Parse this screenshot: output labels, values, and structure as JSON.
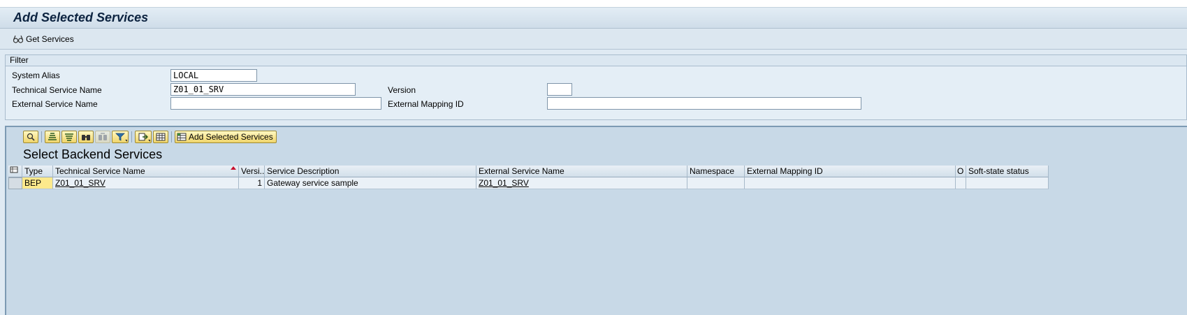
{
  "window": {
    "title": "Add Selected Services"
  },
  "app_toolbar": {
    "get_services_label": "Get Services",
    "get_services_icon": "glasses-icon"
  },
  "filter": {
    "legend": "Filter",
    "system_alias": {
      "label": "System Alias",
      "value": "LOCAL"
    },
    "technical_service_name": {
      "label": "Technical Service Name",
      "value": "Z01_01_SRV"
    },
    "external_service_name": {
      "label": "External Service Name",
      "value": ""
    },
    "version": {
      "label": "Version",
      "value": ""
    },
    "external_mapping_id": {
      "label": "External Mapping ID",
      "value": ""
    }
  },
  "grid": {
    "title": "Select Backend Services",
    "toolbar": {
      "buttons": [
        {
          "name": "details-icon"
        },
        {
          "name": "sort-ascending-icon"
        },
        {
          "name": "sort-descending-icon"
        },
        {
          "name": "find-icon"
        },
        {
          "name": "find-next-icon",
          "disabled": true
        },
        {
          "name": "filter-icon",
          "dropdown": true
        },
        {
          "name": "export-icon",
          "dropdown": true
        },
        {
          "name": "layout-icon"
        }
      ],
      "add_selected_label": "Add Selected Services",
      "add_selected_icon": "table-add-icon"
    },
    "columns": [
      "Type",
      "Technical Service Name",
      "Versi...",
      "Service Description",
      "External Service Name",
      "Namespace",
      "External Mapping ID",
      "O",
      "Soft-state status"
    ],
    "sorted_column": "Technical Service Name",
    "rows": [
      {
        "type": "BEP",
        "technical_service_name": "Z01_01_SRV",
        "version": "1",
        "service_description": "Gateway service sample",
        "external_service_name": "Z01_01_SRV",
        "namespace": "",
        "external_mapping_id": "",
        "o": "",
        "soft_state_status": ""
      }
    ]
  },
  "colors": {
    "background": "#dfeaf3",
    "grid_background": "#c8d9e7",
    "button_yellow": "#f0d56b",
    "key_cell": "#fce98c",
    "sort_indicator": "#c8102e"
  }
}
